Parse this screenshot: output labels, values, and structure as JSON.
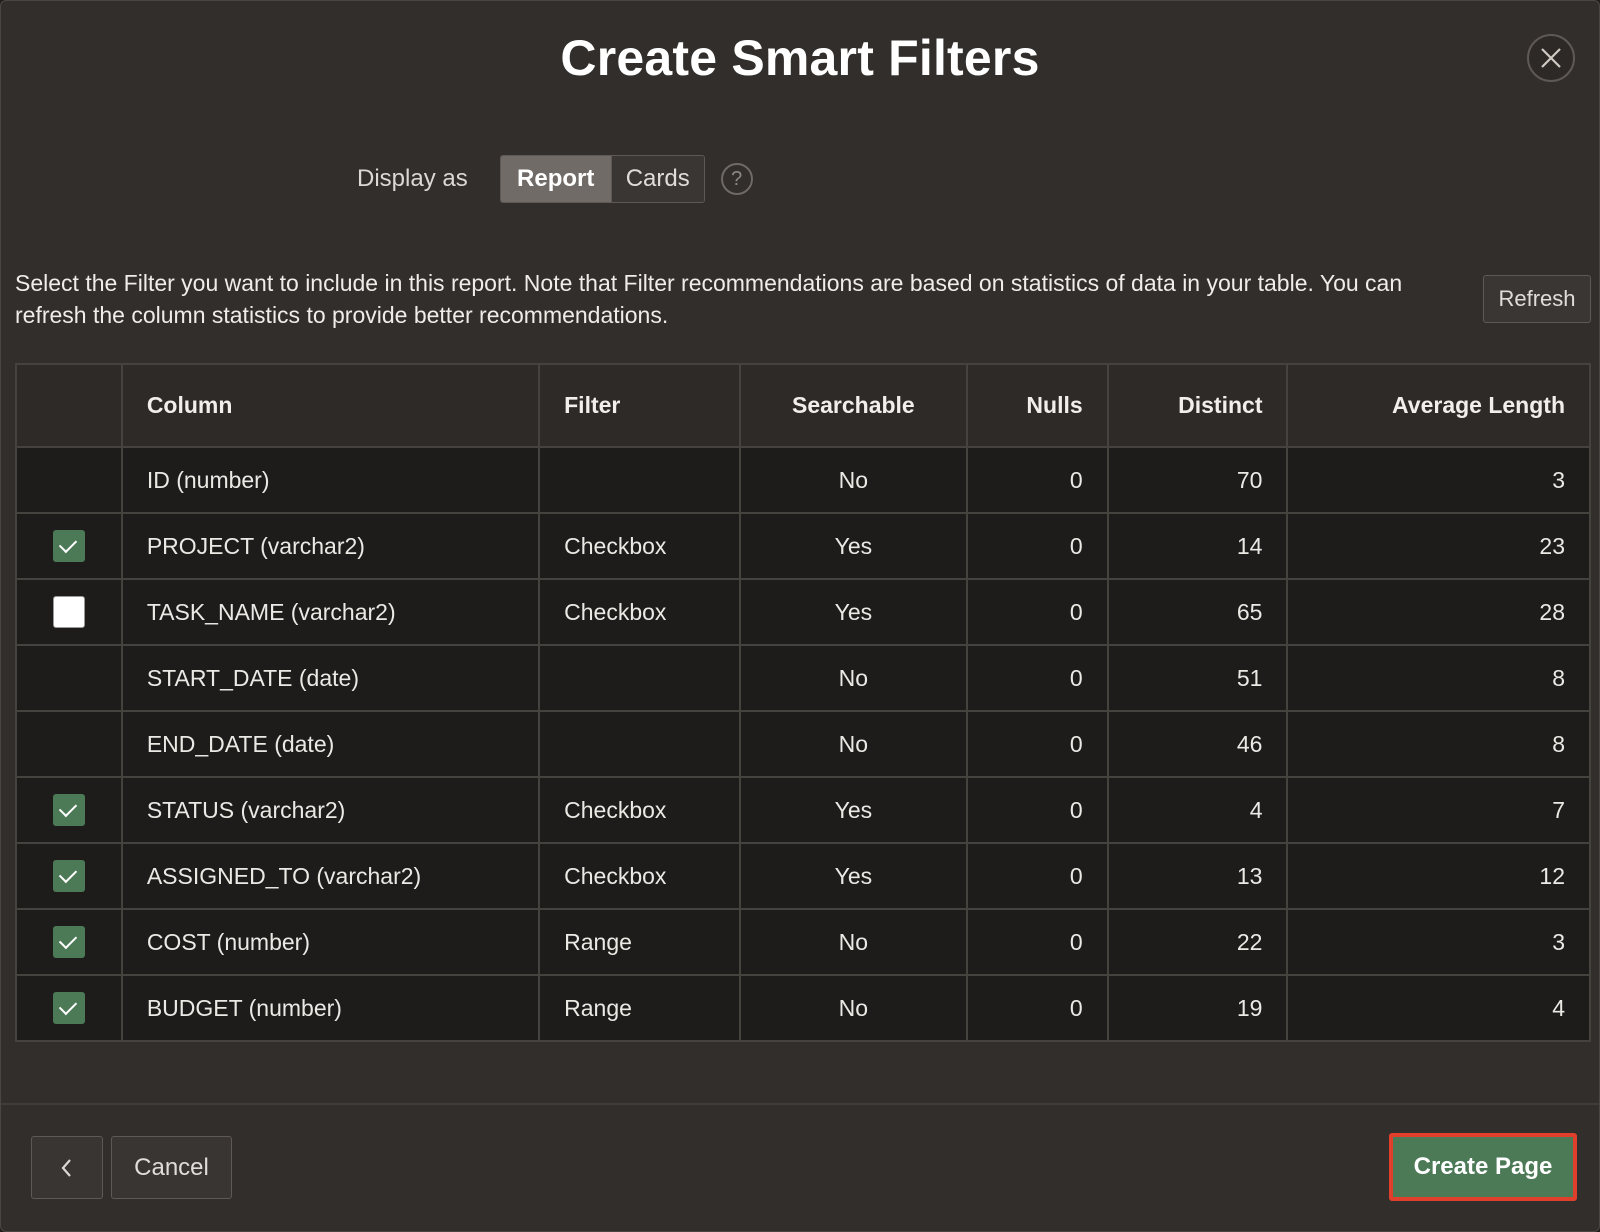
{
  "dialog": {
    "title": "Create Smart Filters",
    "close_icon": "close-icon"
  },
  "display_as": {
    "label": "Display as",
    "options": [
      "Report",
      "Cards"
    ],
    "selected": "Report",
    "help_icon": "help-icon"
  },
  "instruction": "Select the Filter you want to include in this report. Note that Filter recommendations are based on statistics of data in your table. You can refresh the column statistics to provide better recommendations.",
  "refresh_label": "Refresh",
  "table": {
    "headers": [
      "",
      "Column",
      "Filter",
      "Searchable",
      "Nulls",
      "Distinct",
      "Average Length"
    ],
    "rows": [
      {
        "checkbox": "none",
        "column": "ID (number)",
        "filter": "",
        "searchable": "No",
        "nulls": "0",
        "distinct": "70",
        "avg_length": "3"
      },
      {
        "checkbox": "checked",
        "column": "PROJECT (varchar2)",
        "filter": "Checkbox",
        "searchable": "Yes",
        "nulls": "0",
        "distinct": "14",
        "avg_length": "23"
      },
      {
        "checkbox": "unchecked",
        "column": "TASK_NAME (varchar2)",
        "filter": "Checkbox",
        "searchable": "Yes",
        "nulls": "0",
        "distinct": "65",
        "avg_length": "28"
      },
      {
        "checkbox": "none",
        "column": "START_DATE (date)",
        "filter": "",
        "searchable": "No",
        "nulls": "0",
        "distinct": "51",
        "avg_length": "8"
      },
      {
        "checkbox": "none",
        "column": "END_DATE (date)",
        "filter": "",
        "searchable": "No",
        "nulls": "0",
        "distinct": "46",
        "avg_length": "8"
      },
      {
        "checkbox": "checked",
        "column": "STATUS (varchar2)",
        "filter": "Checkbox",
        "searchable": "Yes",
        "nulls": "0",
        "distinct": "4",
        "avg_length": "7"
      },
      {
        "checkbox": "checked",
        "column": "ASSIGNED_TO (varchar2)",
        "filter": "Checkbox",
        "searchable": "Yes",
        "nulls": "0",
        "distinct": "13",
        "avg_length": "12"
      },
      {
        "checkbox": "checked",
        "column": "COST (number)",
        "filter": "Range",
        "searchable": "No",
        "nulls": "0",
        "distinct": "22",
        "avg_length": "3"
      },
      {
        "checkbox": "checked",
        "column": "BUDGET (number)",
        "filter": "Range",
        "searchable": "No",
        "nulls": "0",
        "distinct": "19",
        "avg_length": "4"
      }
    ]
  },
  "footer": {
    "back_icon": "chevron-left-icon",
    "cancel_label": "Cancel",
    "create_label": "Create Page"
  },
  "colors": {
    "accent_green": "#4c7a57",
    "highlight_red": "#e0402b",
    "background": "#312e2b"
  }
}
